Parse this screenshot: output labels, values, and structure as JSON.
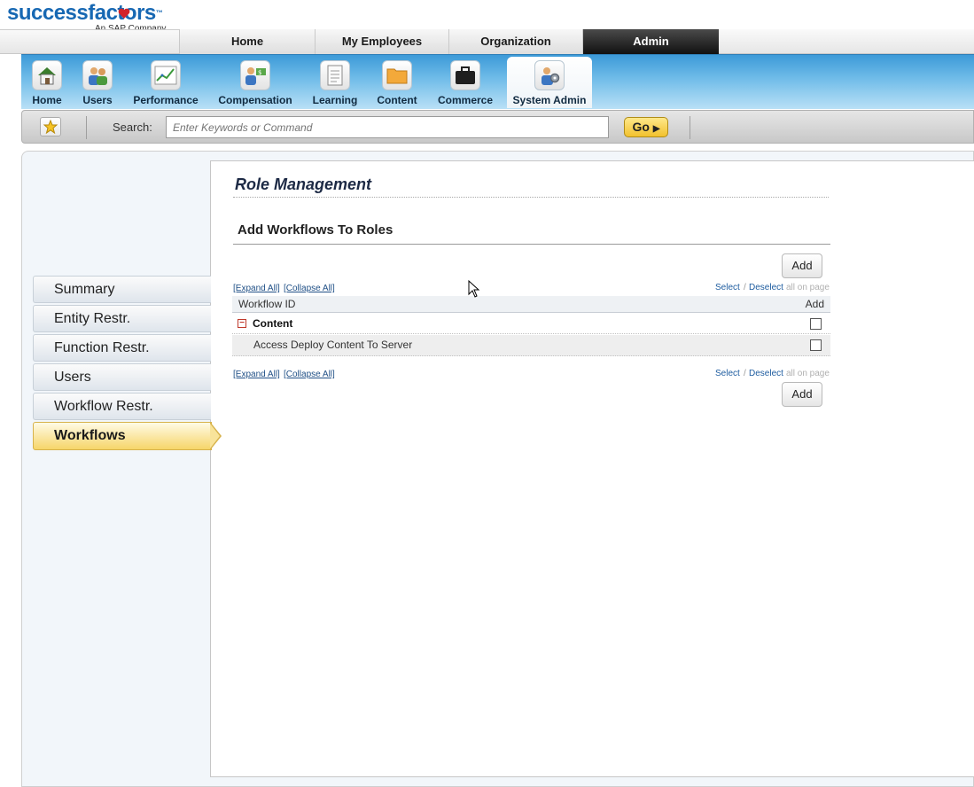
{
  "brand": {
    "logo_text": "successfactors",
    "logo_tm": "™",
    "tagline": "An SAP Company"
  },
  "top_tabs": [
    {
      "label": "Home"
    },
    {
      "label": "My Employees"
    },
    {
      "label": "Organization"
    },
    {
      "label": "Admin",
      "active": true
    }
  ],
  "nav_bar": {
    "items": [
      {
        "label": "Home",
        "icon": "home-icon"
      },
      {
        "label": "Users",
        "icon": "users-icon"
      },
      {
        "label": "Performance",
        "icon": "performance-chart-icon"
      },
      {
        "label": "Compensation",
        "icon": "compensation-icon"
      },
      {
        "label": "Learning",
        "icon": "document-icon"
      },
      {
        "label": "Content",
        "icon": "folder-icon"
      },
      {
        "label": "Commerce",
        "icon": "briefcase-icon"
      },
      {
        "label": "System Admin",
        "icon": "system-admin-icon",
        "active": true
      }
    ]
  },
  "search": {
    "label": "Search:",
    "placeholder": "Enter Keywords or Command",
    "go_label": "Go"
  },
  "side_nav": {
    "items": [
      {
        "label": "Summary"
      },
      {
        "label": "Entity Restr."
      },
      {
        "label": "Function Restr."
      },
      {
        "label": "Users"
      },
      {
        "label": "Workflow Restr."
      },
      {
        "label": "Workflows",
        "active": true
      }
    ]
  },
  "main": {
    "page_title": "Role Management",
    "section_title": "Add Workflows To Roles",
    "add_label": "Add",
    "expand_all": "[Expand All]",
    "collapse_all": "[Collapse All]",
    "select_label": "Select",
    "slash": "/",
    "deselect_label": "Deselect",
    "all_on_page": "all on page",
    "table": {
      "columns": [
        "Workflow ID",
        "Add"
      ],
      "group": {
        "label": "Content",
        "checked": false
      },
      "rows": [
        {
          "label": "Access Deploy Content To Server",
          "checked": false
        }
      ]
    }
  },
  "colors": {
    "brand_blue": "#1768b3",
    "heart_red": "#d2232a",
    "admin_tab": "#1a1a1a",
    "active_side": "#f6d569",
    "go_button": "#f2c12e"
  }
}
